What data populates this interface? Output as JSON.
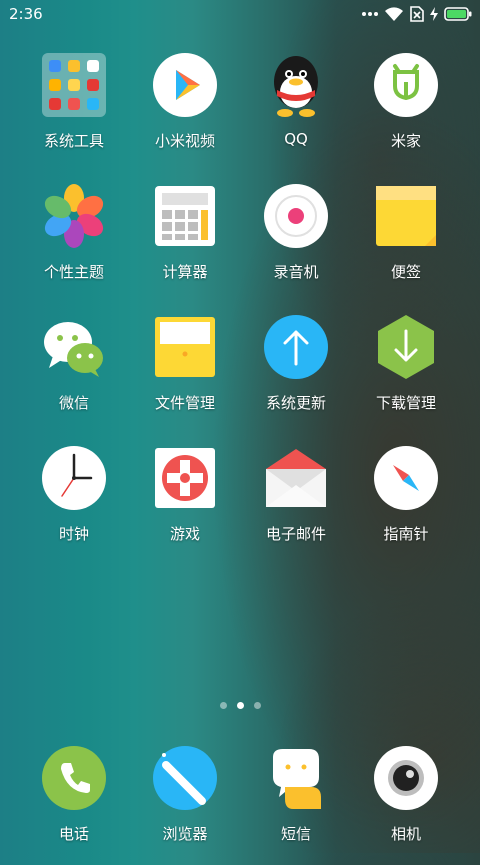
{
  "status_bar": {
    "time": "2:36"
  },
  "apps": [
    {
      "label": "系统工具",
      "icon": "folder-icon"
    },
    {
      "label": "小米视频",
      "icon": "video-play-icon"
    },
    {
      "label": "QQ",
      "icon": "qq-penguin-icon"
    },
    {
      "label": "米家",
      "icon": "mijia-icon"
    },
    {
      "label": "个性主题",
      "icon": "theme-pinwheel-icon"
    },
    {
      "label": "计算器",
      "icon": "calculator-icon"
    },
    {
      "label": "录音机",
      "icon": "recorder-icon"
    },
    {
      "label": "便签",
      "icon": "notes-icon"
    },
    {
      "label": "微信",
      "icon": "wechat-icon"
    },
    {
      "label": "文件管理",
      "icon": "file-manager-icon"
    },
    {
      "label": "系统更新",
      "icon": "system-update-icon"
    },
    {
      "label": "下载管理",
      "icon": "download-manager-icon"
    },
    {
      "label": "时钟",
      "icon": "clock-icon"
    },
    {
      "label": "游戏",
      "icon": "games-icon"
    },
    {
      "label": "电子邮件",
      "icon": "email-icon"
    },
    {
      "label": "指南针",
      "icon": "compass-icon"
    }
  ],
  "page_indicator": {
    "pages": 3,
    "current": 2
  },
  "dock": [
    {
      "label": "电话",
      "icon": "phone-icon"
    },
    {
      "label": "浏览器",
      "icon": "browser-icon"
    },
    {
      "label": "短信",
      "icon": "messages-icon"
    },
    {
      "label": "相机",
      "icon": "camera-icon"
    }
  ]
}
